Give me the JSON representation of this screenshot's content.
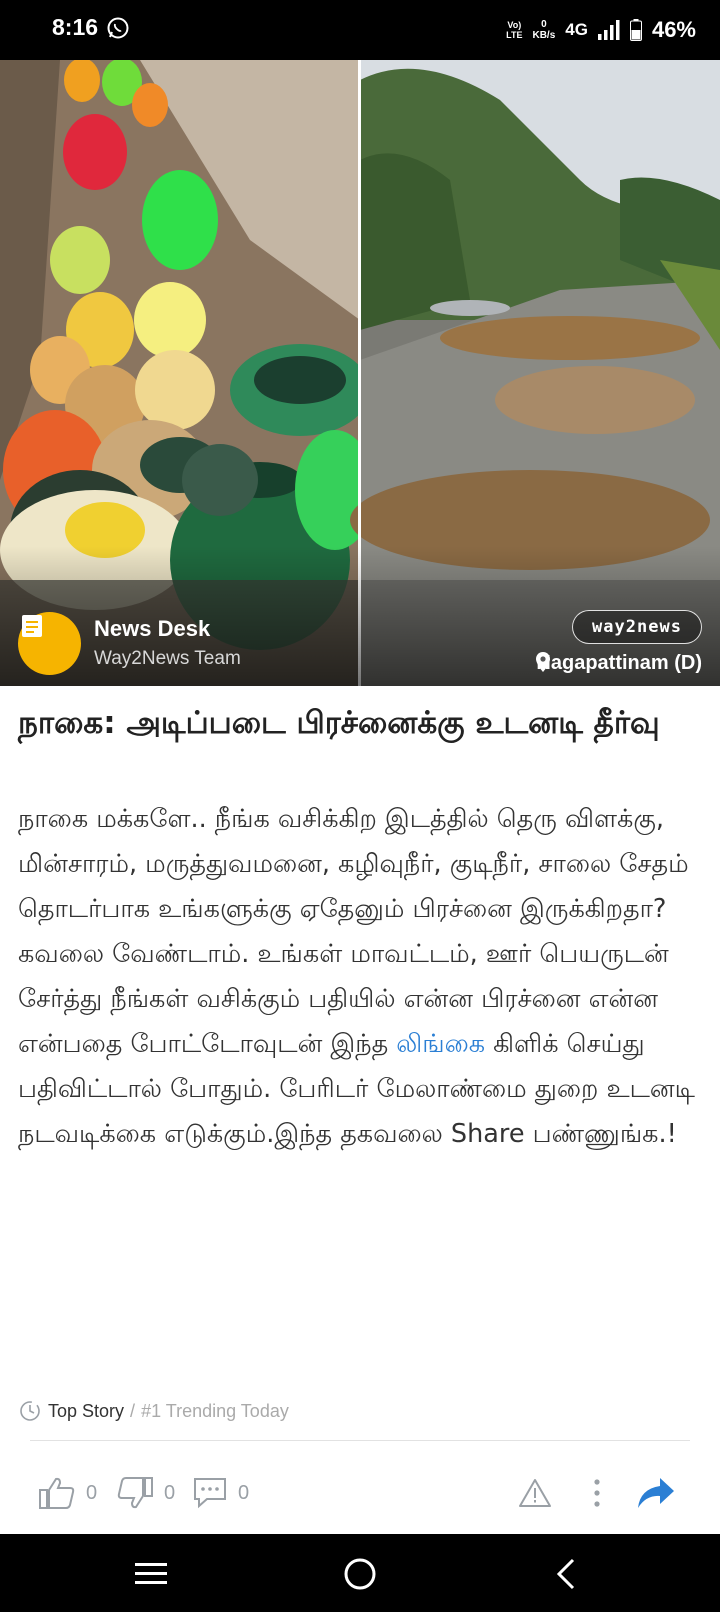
{
  "status_bar": {
    "time": "8:16",
    "volte": [
      "Vo)",
      "LTE"
    ],
    "speed": [
      "0",
      "KB/s"
    ],
    "network": "4G",
    "battery": "46%"
  },
  "article": {
    "author_name": "News Desk",
    "author_team": "Way2News Team",
    "brand": "way2news",
    "location": "Nagapattinam (D)",
    "headline": "நாகை: அடிப்படை பிரச்னைக்கு உடனடி தீர்வு",
    "body_part1": "நாகை மக்களே.. நீங்க வசிக்கிற இடத்தில் தெரு விளக்கு, மின்சாரம், மருத்துவமனை, கழிவுநீர், குடிநீர், சாலை சேதம் தொடர்பாக உங்களுக்கு ஏதேனும் பிரச்னை இருக்கிறதா? கவலை வேண்டாம். உங்கள் மாவட்டம், ஊர் பெயருடன் சேர்த்து நீங்கள் வசிக்கும் பதியில் என்ன பிரச்னை என்ன என்பதை போட்டோவுடன் இந்த ",
    "body_link": "லிங்கை",
    "body_part2": " கிளிக் செய்து பதிவிட்டால் போதும். பேரிடர் மேலாண்மை துறை உடனடி நடவடிக்கை எடுக்கும்.இந்த தகவலை Share பண்ணுங்க.!"
  },
  "meta": {
    "label": "Top Story",
    "separator": "/",
    "trending": "#1 Trending Today"
  },
  "actions": {
    "likes": "0",
    "dislikes": "0",
    "comments": "0"
  },
  "colors": {
    "accent": "#2b7fd4",
    "avatar": "#f6b400",
    "bars": "#000000"
  },
  "icons": [
    "whatsapp-icon",
    "signal-icon",
    "battery-icon",
    "document-icon",
    "location-pin-icon",
    "clock-icon",
    "like-icon",
    "dislike-icon",
    "comment-icon",
    "report-icon",
    "more-icon",
    "share-icon",
    "recents-icon",
    "home-icon",
    "back-icon"
  ]
}
